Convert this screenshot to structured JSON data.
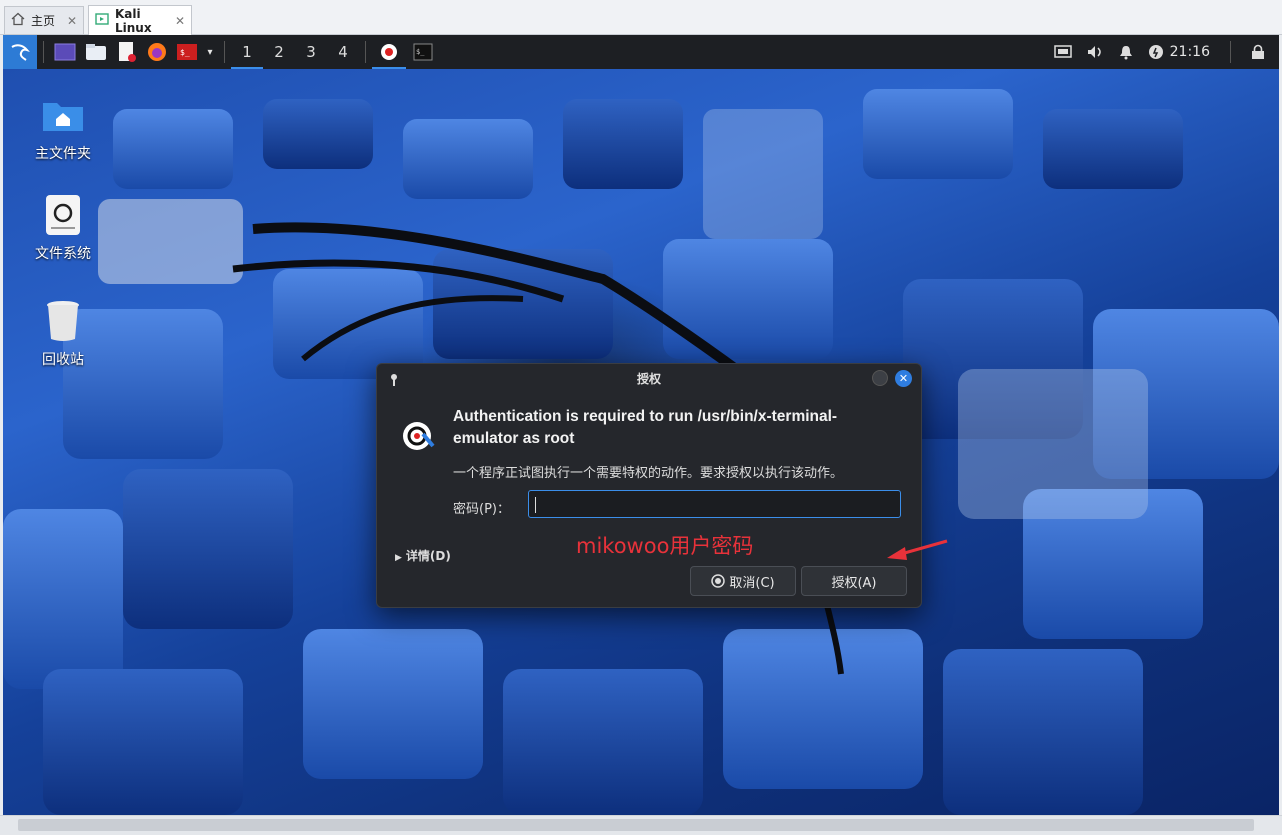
{
  "host_tabs": [
    {
      "label": "主页",
      "icon": "home-icon"
    },
    {
      "label": "Kali Linux",
      "icon": "vm-icon"
    }
  ],
  "panel": {
    "workspaces": [
      "1",
      "2",
      "3",
      "4"
    ],
    "active_workspace": "1",
    "clock": "21:16"
  },
  "desktop_icons": [
    {
      "label": "主文件夹",
      "icon": "home-folder-icon"
    },
    {
      "label": "文件系统",
      "icon": "drive-icon"
    },
    {
      "label": "回收站",
      "icon": "trash-icon"
    }
  ],
  "dialog": {
    "title": "授权",
    "headline": "Authentication is required to run /usr/bin/x-terminal-emulator as root",
    "description": "一个程序正试图执行一个需要特权的动作。要求授权以执行该动作。",
    "password_label": "密码(P)：",
    "password_value": "",
    "details_label": "详情(D)",
    "cancel_label": "取消(C)",
    "authorize_label": "授权(A)"
  },
  "annotation": {
    "text": "mikowoo用户密码",
    "color": "#e8323a"
  },
  "colors": {
    "accent": "#3b8eea",
    "panel_bg": "#1d1f23",
    "dialog_bg": "#25272c"
  }
}
